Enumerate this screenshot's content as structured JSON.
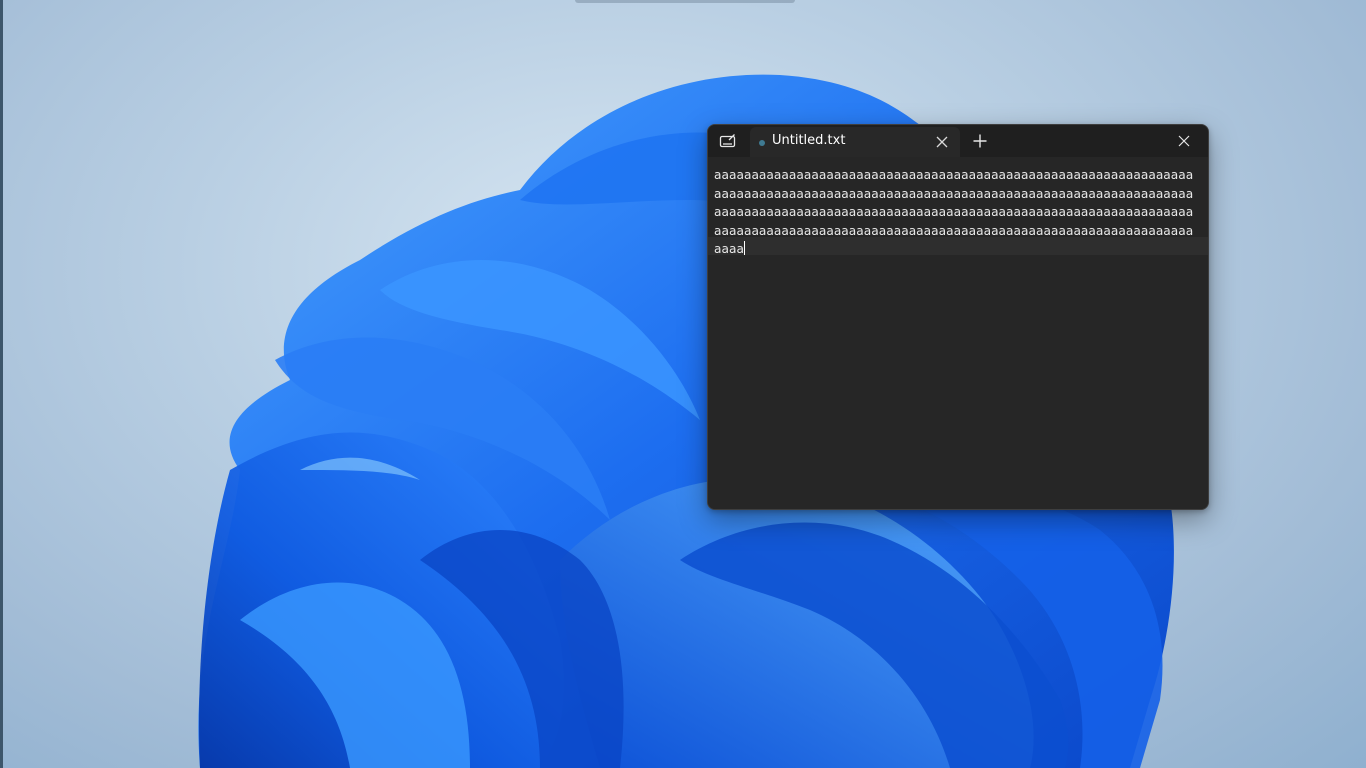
{
  "desktop": {
    "wallpaper": "windows-11-bloom",
    "colors": {
      "background": "#b9cfe3",
      "bloom_dark": "#0a47c9",
      "bloom_mid": "#1d6ef0",
      "bloom_light": "#4aa3ff"
    }
  },
  "notepad": {
    "app_icon": "notepad-icon",
    "tabs": [
      {
        "title": "Untitled.txt",
        "unsaved": true,
        "close_icon": "close-icon"
      }
    ],
    "new_tab_icon": "plus-icon",
    "window_close_icon": "close-icon",
    "content": "aaaaaaaaaaaaaaaaaaaaaaaaaaaaaaaaaaaaaaaaaaaaaaaaaaaaaaaaaaaaaaaaaaaaaaaaaaaaaaaaaaaaaaaaaaaaaaaaaaaaaaaaaaaaaaaaaaaaaaaaaaaaaaaaaaaaaaaaaaaaaaaaaaaaaaaaaaaaaaaaaaaaaaaaaaaaaaaaaaaaaaaaaaaaaaaaaaaaaaaaaaaaaaaaaaaaaaaaaaaaaaaaaaaaaaaaaaaaaaaaaaaaaaaaaaaaaaaaaaaa",
    "colors": {
      "window_bg": "#262626",
      "titlebar_bg": "#1f1f1f",
      "tab_bg": "#282828",
      "text": "#e8e8e8",
      "unsaved_dot": "#3f7a92"
    }
  }
}
